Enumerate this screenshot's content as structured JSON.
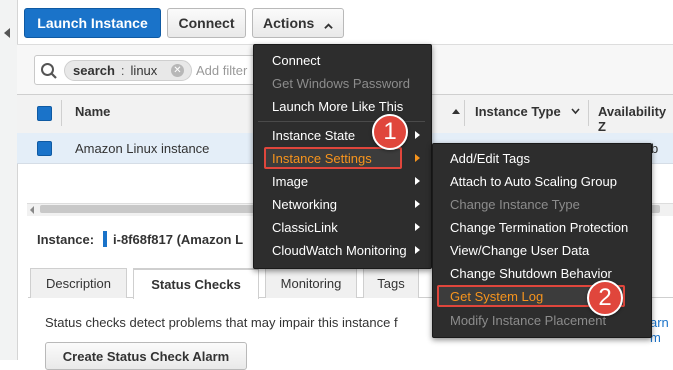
{
  "toolbar": {
    "launch_label": "Launch Instance",
    "connect_label": "Connect",
    "actions_label": "Actions"
  },
  "search": {
    "chip_key": "search",
    "chip_sep": ":",
    "chip_value": "linux",
    "placeholder": "Add filter"
  },
  "table": {
    "headers": {
      "name": "Name",
      "instance_type": "Instance Type",
      "availability_zone": "Availability Z"
    },
    "row": {
      "name": "Amazon Linux instance",
      "zone_partial": "b"
    }
  },
  "instance": {
    "label": "Instance:",
    "id": "i-8f68f817 (Amazon L"
  },
  "tabs": [
    "Description",
    "Status Checks",
    "Monitoring",
    "Tags"
  ],
  "status": {
    "text": "Status checks detect problems that may impair this instance f",
    "learn_more": "arn m",
    "alarm_button": "Create Status Check Alarm"
  },
  "actions_menu": {
    "items": [
      {
        "label": "Connect",
        "enabled": true
      },
      {
        "label": "Get Windows Password",
        "enabled": false
      },
      {
        "label": "Launch More Like This",
        "enabled": true
      },
      {
        "label": "Instance State",
        "enabled": true
      },
      {
        "label": "Instance Settings",
        "enabled": true
      },
      {
        "label": "Image",
        "enabled": true
      },
      {
        "label": "Networking",
        "enabled": true
      },
      {
        "label": "ClassicLink",
        "enabled": true
      },
      {
        "label": "CloudWatch Monitoring",
        "enabled": true
      }
    ]
  },
  "settings_submenu": {
    "items": [
      {
        "label": "Add/Edit Tags",
        "enabled": true
      },
      {
        "label": "Attach to Auto Scaling Group",
        "enabled": true
      },
      {
        "label": "Change Instance Type",
        "enabled": false
      },
      {
        "label": "Change Termination Protection",
        "enabled": true
      },
      {
        "label": "View/Change User Data",
        "enabled": true
      },
      {
        "label": "Change Shutdown Behavior",
        "enabled": true
      },
      {
        "label": "Get System Log",
        "enabled": true
      },
      {
        "label": "Modify Instance Placement",
        "enabled": false
      }
    ]
  },
  "steps": [
    "1",
    "2"
  ],
  "colors": {
    "primary": "#1a73c9",
    "menu_bg": "#2d2d2d",
    "highlight": "#f7941d",
    "callout": "#e0463c"
  }
}
